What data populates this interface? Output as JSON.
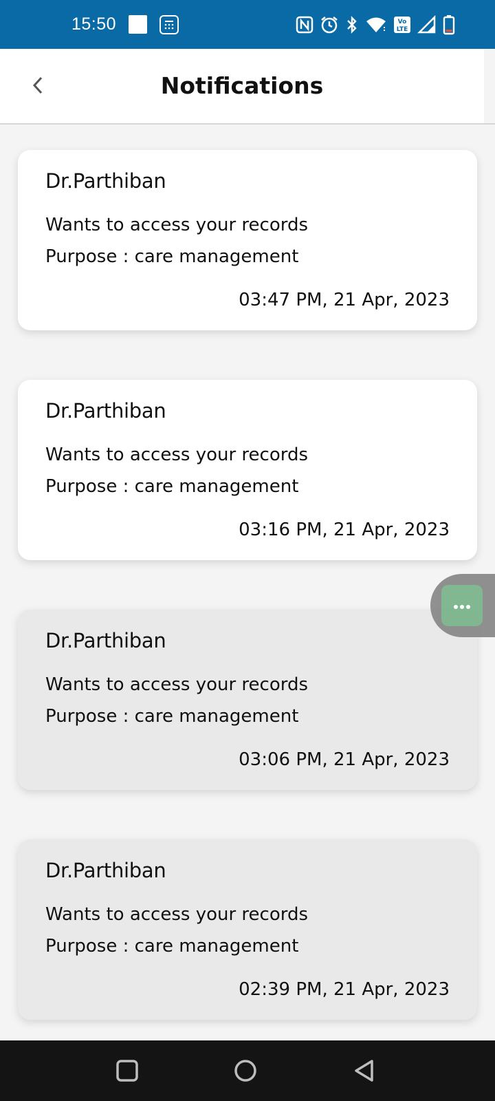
{
  "status_bar": {
    "time": "15:50",
    "icons": [
      "notification-square-icon",
      "calculator-icon",
      "nfc-icon",
      "alarm-icon",
      "bluetooth-icon",
      "wifi-icon",
      "volte-icon",
      "signal-icon",
      "battery-icon"
    ],
    "volte_label": "Vo LTE"
  },
  "header": {
    "title": "Notifications",
    "back_icon": "chevron-left-icon"
  },
  "notifications": [
    {
      "sender": "Dr.Parthiban",
      "message": "Wants to access your records",
      "purpose": "Purpose : care management",
      "time": "03:47 PM, 21 Apr, 2023",
      "read": false
    },
    {
      "sender": "Dr.Parthiban",
      "message": "Wants to access your records",
      "purpose": "Purpose : care management",
      "time": "03:16 PM, 21 Apr, 2023",
      "read": false
    },
    {
      "sender": "Dr.Parthiban",
      "message": "Wants to access your records",
      "purpose": "Purpose : care management",
      "time": "03:06 PM, 21 Apr, 2023",
      "read": true
    },
    {
      "sender": "Dr.Parthiban",
      "message": "Wants to access your records",
      "purpose": "Purpose : care management",
      "time": "02:39 PM, 21 Apr, 2023",
      "read": true
    }
  ],
  "floating_button": {
    "icon": "more-horizontal-icon"
  },
  "nav_bar": {
    "icons": [
      "recents-square-icon",
      "home-circle-icon",
      "back-triangle-icon"
    ]
  },
  "colors": {
    "status_bar": "#0a6aa6",
    "unread_card": "#ffffff",
    "read_card": "#e9e9e9",
    "floating_accent": "#7bb58c",
    "nav_bar": "#141414"
  }
}
